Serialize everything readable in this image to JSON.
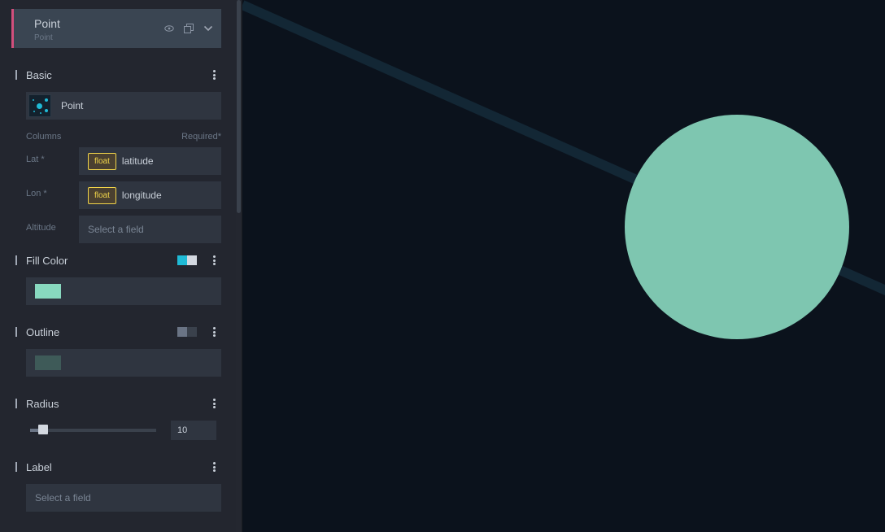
{
  "layer": {
    "title": "Point",
    "subtitle": "Point",
    "accent_color": "#d14f7c",
    "icons": [
      "eye-icon",
      "duplicate-icon",
      "chevron-down-icon"
    ]
  },
  "basic": {
    "section_label": "Basic",
    "layer_type": "Point",
    "columns_label": "Columns",
    "required_label": "Required*"
  },
  "columns": [
    {
      "label": "Lat *",
      "type": "float",
      "value": "latitude"
    },
    {
      "label": "Lon *",
      "type": "float",
      "value": "longitude"
    },
    {
      "label": "Altitude",
      "placeholder": "Select a field"
    }
  ],
  "fill_color": {
    "section_label": "Fill Color",
    "color": "#88d9bf",
    "toggle_colors": [
      "#1fbad6",
      "#d3d8e0"
    ]
  },
  "outline": {
    "section_label": "Outline",
    "color": "#3e5a58",
    "toggle_colors": [
      "#6a7485",
      "#3a414c"
    ]
  },
  "radius": {
    "section_label": "Radius",
    "value": "10",
    "slider_fraction": 0.1
  },
  "label": {
    "section_label": "Label",
    "placeholder": "Select a field"
  },
  "map": {
    "background": "#0b121c",
    "point_color": "#7ec6b0",
    "line_color": "#132735"
  }
}
